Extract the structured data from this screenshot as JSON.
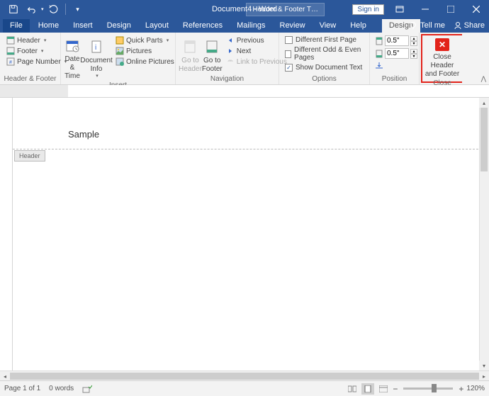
{
  "title": "Document4 - Word",
  "contextual_label": "Header & Footer T…",
  "signin": "Sign in",
  "tabs": {
    "file": "File",
    "home": "Home",
    "insert": "Insert",
    "design_main": "Design",
    "layout": "Layout",
    "references": "References",
    "mailings": "Mailings",
    "review": "Review",
    "view": "View",
    "help": "Help",
    "design_ctx": "Design"
  },
  "tellme": "Tell me",
  "share": "Share",
  "ribbon": {
    "hf": {
      "header": "Header",
      "footer": "Footer",
      "pagenum": "Page Number",
      "group": "Header & Footer"
    },
    "insert": {
      "date": "Date &",
      "time": "Time",
      "docinfo1": "Document",
      "docinfo2": "Info",
      "quickparts": "Quick Parts",
      "pictures": "Pictures",
      "online": "Online Pictures",
      "group": "Insert"
    },
    "nav": {
      "gotoh1": "Go to",
      "gotoh2": "Header",
      "gotof1": "Go to",
      "gotof2": "Footer",
      "prev": "Previous",
      "next": "Next",
      "link": "Link to Previous",
      "group": "Navigation"
    },
    "options": {
      "diff_first": "Different First Page",
      "diff_odd": "Different Odd & Even Pages",
      "show_doc": "Show Document Text",
      "group": "Options"
    },
    "position": {
      "top": "0.5\"",
      "bottom": "0.5\"",
      "group": "Position"
    },
    "close": {
      "line1": "Close Header",
      "line2": "and Footer",
      "group": "Close"
    }
  },
  "document": {
    "header_text": "Sample",
    "header_tag": "Header"
  },
  "status": {
    "page": "Page 1 of 1",
    "words": "0 words",
    "zoom": "120%"
  }
}
